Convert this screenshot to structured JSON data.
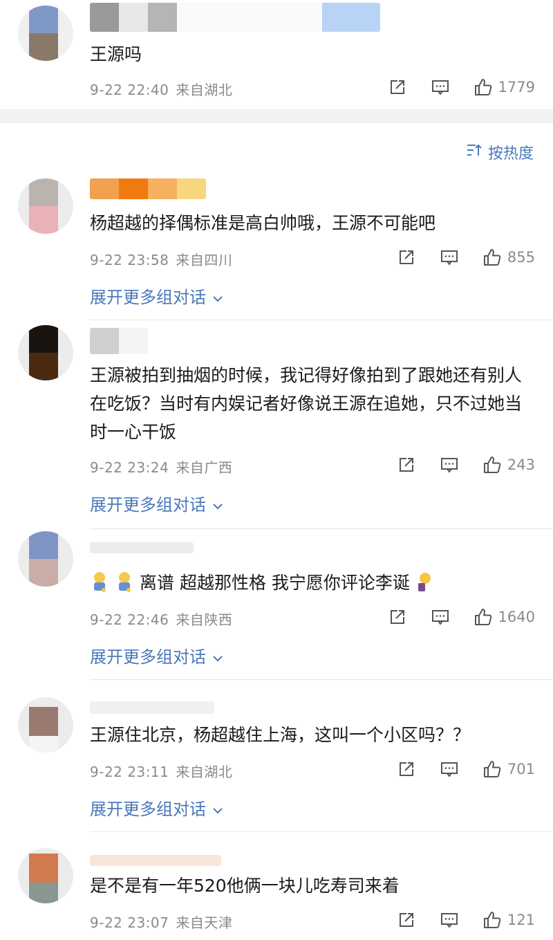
{
  "sort": {
    "label": "按热度",
    "icon": "sort-icon"
  },
  "expand_label": "展开更多组对话",
  "comments": [
    {
      "text": "王源吗",
      "date": "9-22 22:40",
      "location": "来自湖北",
      "likes": "1779",
      "avatar_colors": [
        "#7f99c7",
        "#8a7868"
      ],
      "name_colors": [
        "#9a9a9a",
        "#e8e8e8",
        "#b5b5b5",
        "#ffffff",
        "#ffffff",
        "#ffffff",
        "#ffffff",
        "#b9d3f5"
      ]
    },
    {
      "text": "杨超越的择偶标准是高白帅哦，王源不可能吧",
      "date": "9-22 23:58",
      "location": "来自四川",
      "likes": "855",
      "avatar_colors": [
        "#bbb3ae",
        "#e8b2b6"
      ],
      "name_colors": [
        "#f2a050",
        "#f07a10",
        "#f6b060",
        "#f8d680"
      ]
    },
    {
      "text": "王源被拍到抽烟的时候，我记得好像拍到了跟她还有别人在吃饭？当时有内娱记者好像说王源在追她，只不过她当时一心干饭",
      "date": "9-22 23:24",
      "location": "来自广西",
      "likes": "243",
      "avatar_colors": [
        "#1a1410",
        "#4a2a10"
      ],
      "name_colors": [
        "#d0d0d0",
        "#f4f4f4"
      ]
    },
    {
      "text": "离谱 超越那性格 我宁愿你评论李诞",
      "date": "9-22 22:46",
      "location": "来自陕西",
      "likes": "1640",
      "avatar_colors": [
        "#7f95c6",
        "#c8aea6"
      ],
      "name_colors": [
        "#e8e8e8"
      ]
    },
    {
      "text": "王源住北京，杨超越住上海，这叫一个小区吗？？",
      "date": "9-22 23:11",
      "location": "来自湖北",
      "likes": "701",
      "avatar_colors": [
        "#9a7a70",
        "#f2f2f2"
      ],
      "name_colors": [
        "#eeeeee"
      ]
    },
    {
      "text": "是不是有一年520他俩一块儿吃寿司来着",
      "date": "9-22 23:07",
      "location": "来自天津",
      "likes": "121",
      "avatar_colors": [
        "#d07a50",
        "#8a9690"
      ],
      "name_colors": [
        "#f6e4d8"
      ]
    }
  ]
}
